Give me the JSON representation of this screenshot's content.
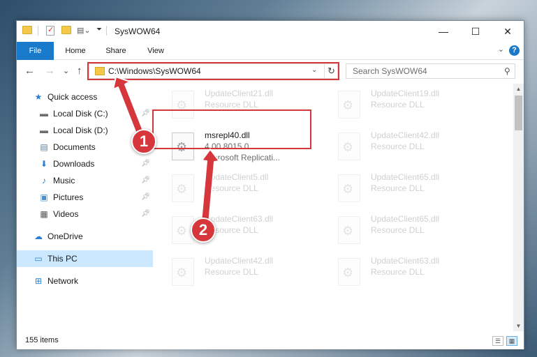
{
  "window": {
    "title": "SysWOW64"
  },
  "ribbon": {
    "tabs": [
      "File",
      "Home",
      "Share",
      "View"
    ],
    "help": "?"
  },
  "nav": {
    "back": "←",
    "forward": "→",
    "recent": "⌄",
    "up": "↑"
  },
  "address": {
    "path": "C:\\Windows\\SysWOW64",
    "dropdown": "⌄",
    "refresh": "↻"
  },
  "search": {
    "placeholder": "Search SysWOW64",
    "icon": "⚲"
  },
  "sidebar": {
    "items": [
      {
        "label": "Quick access",
        "icon": "★"
      },
      {
        "label": "Local Disk (C:)",
        "icon": "▬"
      },
      {
        "label": "Local Disk (D:)",
        "icon": "▬"
      },
      {
        "label": "Documents",
        "icon": "▤"
      },
      {
        "label": "Downloads",
        "icon": "⬇"
      },
      {
        "label": "Music",
        "icon": "♪"
      },
      {
        "label": "Pictures",
        "icon": "▣"
      },
      {
        "label": "Videos",
        "icon": "▦"
      },
      {
        "label": "OneDrive",
        "icon": "☁"
      },
      {
        "label": "This PC",
        "icon": "▭"
      },
      {
        "label": "Network",
        "icon": "⊞"
      }
    ]
  },
  "files": {
    "col1": [
      {
        "name": "UpdateClient21.dll",
        "type": "Resource DLL"
      },
      {
        "name": "UpdateClient5.dll",
        "type": "Resource DLL"
      },
      {
        "name": "UpdateClient63.dll",
        "type": "Resource DLL"
      },
      {
        "name": "UpdateClient42.dll",
        "type": "Resource DLL"
      }
    ],
    "col2": [
      {
        "name": "UpdateClient19.dll",
        "type": "Resource DLL"
      },
      {
        "name": "UpdateClient42.dll",
        "type": "Resource DLL"
      },
      {
        "name": "UpdateClient65.dll",
        "type": "Resource DLL"
      },
      {
        "name": "UpdateClient65.dll",
        "type": "Resource DLL"
      },
      {
        "name": "UpdateClient63.dll",
        "type": "Resource DLL"
      }
    ],
    "highlighted": {
      "name": "msrepl40.dll",
      "version": "4.00.8015.0",
      "description": "Microsoft Replicati..."
    }
  },
  "status": {
    "count": "155 items"
  },
  "annotations": {
    "step1": "1",
    "step2": "2",
    "color": "#d6373c"
  }
}
